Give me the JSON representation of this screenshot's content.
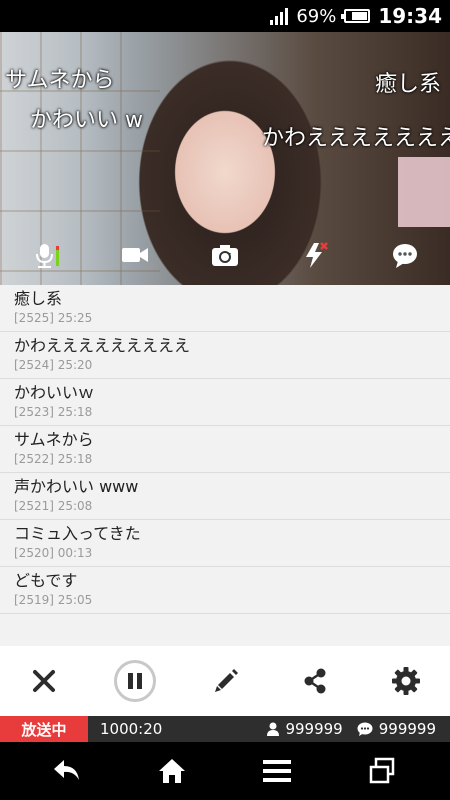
{
  "status_bar": {
    "battery": "69%",
    "time": "19:34"
  },
  "video": {
    "overlay_comments": [
      "サムネから",
      "癒し系",
      "かわいい w",
      "かわえええええええ"
    ]
  },
  "comments": [
    {
      "text": "癒し系",
      "meta": "[2525] 25:25"
    },
    {
      "text": "かわえええええええええ",
      "meta": "[2524] 25:20"
    },
    {
      "text": "かわいいｗ",
      "meta": "[2523] 25:18"
    },
    {
      "text": "サムネから",
      "meta": "[2522] 25:18"
    },
    {
      "text": "声かわいい www",
      "meta": "[2521] 25:08"
    },
    {
      "text": "コミュ入ってきた",
      "meta": "[2520] 00:13"
    },
    {
      "text": "どもです",
      "meta": "[2519] 25:05"
    }
  ],
  "info_bar": {
    "status": "放送中",
    "elapsed": "1000:20",
    "viewers": "999999",
    "comment_count": "999999"
  },
  "colors": {
    "onair": "#e83c3c",
    "info_bg": "#2e2e2e",
    "mic_level": "#7bd11c"
  }
}
